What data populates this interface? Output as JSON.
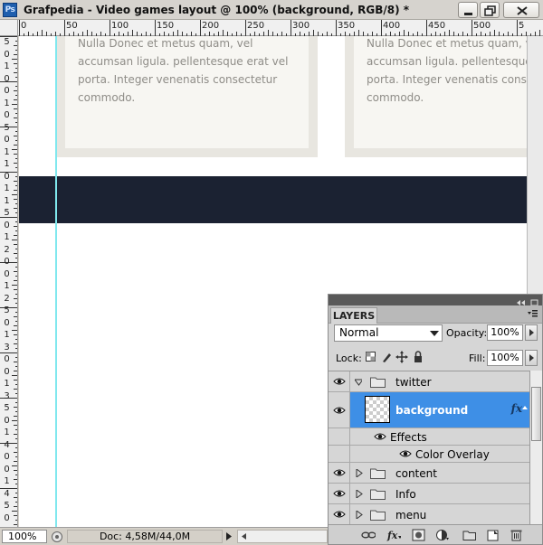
{
  "window": {
    "app_icon_text": "Ps",
    "title": "Grafpedia - Video games layout @ 100% (background, RGB/8) *"
  },
  "ruler_top": {
    "labels": [
      "0",
      "50",
      "100",
      "150",
      "200",
      "250",
      "300",
      "350",
      "400",
      "450",
      "500",
      "5"
    ]
  },
  "ruler_left": {
    "labels": [
      "5",
      "0",
      "1",
      "0",
      "0",
      "1",
      "0",
      "5",
      "0",
      "1",
      "1",
      "0",
      "1",
      "1",
      "5",
      "0",
      "1",
      "2",
      "0",
      "0",
      "1",
      "2",
      "5",
      "0",
      "1",
      "3",
      "0",
      "0",
      "1",
      "3",
      "5",
      "0",
      "1",
      "4",
      "0",
      "0",
      "1",
      "4",
      "5",
      "0"
    ]
  },
  "canvas": {
    "card_text": "Nulla Donec et metus quam, vel accumsan ligula.  pellentesque erat vel porta. Integer venenatis consectetur commodo.",
    "card_text_right": "Nulla Donec et metus quam, vel accumsan ligula.  pellentesque erat vel porta. Integer venenatis consectetur commodo.",
    "colors": {
      "card_border": "#e8e6e0",
      "card_fill": "#f7f6f2",
      "dark_band": "#1b2232",
      "guide": "#80e8ee"
    }
  },
  "status_bar": {
    "zoom": "100%",
    "doc": "Doc: 4,58M/44,0M"
  },
  "layers_panel": {
    "tab_label": "LAYERS",
    "blend_mode": "Normal",
    "opacity_label": "Opacity:",
    "opacity_value": "100%",
    "lock_label": "Lock:",
    "fill_label": "Fill:",
    "fill_value": "100%",
    "layers": {
      "twitter": "twitter",
      "background": "background",
      "background_fx": "fx",
      "effects": "Effects",
      "color_overlay": "Color Overlay",
      "content": "content",
      "info": "Info",
      "menu": "menu"
    },
    "selection_color": "#3e8fe6"
  }
}
